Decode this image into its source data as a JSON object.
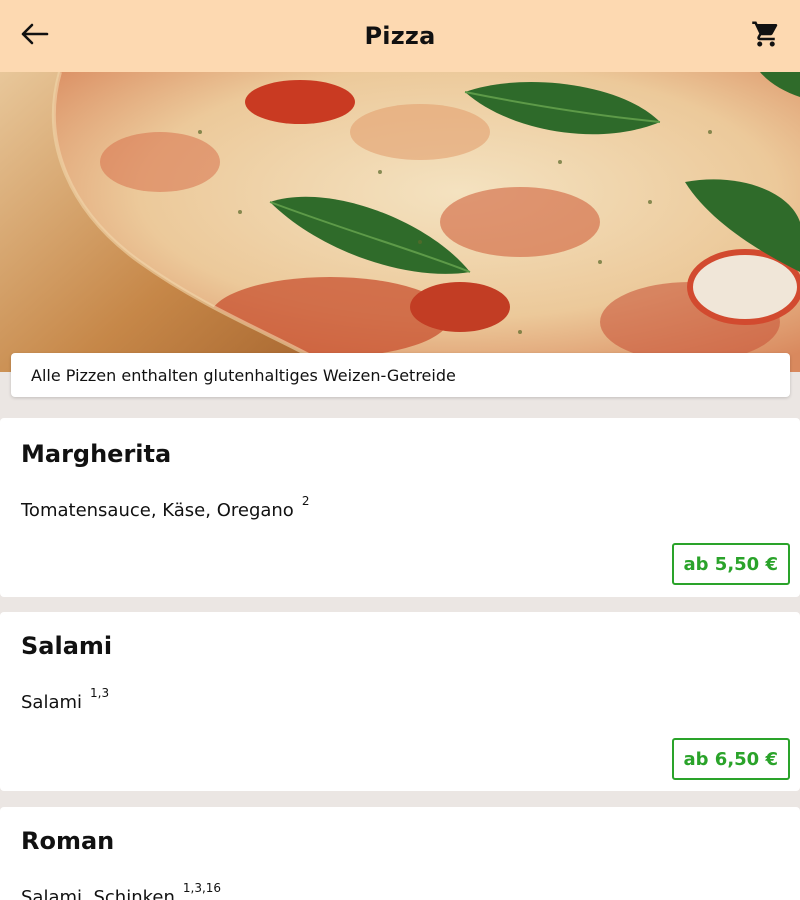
{
  "header": {
    "title": "Pizza",
    "back_icon": "arrow-left-icon",
    "cart_icon": "shopping-cart-icon",
    "background": "#fdd9b1"
  },
  "notice": {
    "text": "Alle Pizzen enthalten glutenhaltiges Weizen-Getreide"
  },
  "items": [
    {
      "name": "Margherita",
      "description": "Tomatensauce, Käse, Oregano",
      "allergens": "2",
      "price": "ab 5,50 €"
    },
    {
      "name": "Salami",
      "description": "Salami",
      "allergens": "1,3",
      "price": "ab 6,50 €"
    },
    {
      "name": "Roman",
      "description": "Salami, Schinken",
      "allergens": "1,3,16",
      "price": ""
    }
  ],
  "colors": {
    "accent_green": "#2aa32a",
    "page_background": "#ebe6e3"
  }
}
